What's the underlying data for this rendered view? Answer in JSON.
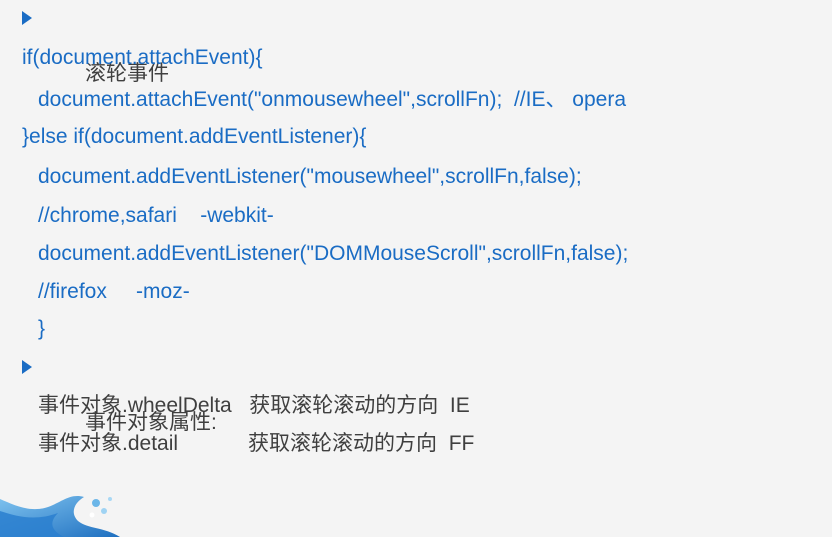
{
  "slide": {
    "bullet1": {
      "icon": "arrow-bullet-icon",
      "text": "滚轮事件"
    },
    "code_lines": [
      "if(document.attachEvent){",
      "document.attachEvent(\"onmousewheel\",scrollFn);  //IE、 opera",
      "}else if(document.addEventListener){",
      "document.addEventListener(\"mousewheel\",scrollFn,false);",
      "//chrome,safari    -webkit-",
      "document.addEventListener(\"DOMMouseScroll\",scrollFn,false);",
      "//firefox     -moz-",
      "}"
    ],
    "bullet2": {
      "icon": "arrow-bullet-icon",
      "text": "事件对象属性:"
    },
    "properties": [
      "事件对象.wheelDelta   获取滚轮滚动的方向  IE",
      "事件对象.detail            获取滚轮滚动的方向  FF"
    ],
    "colors": {
      "blue": "#1a6cc4",
      "dark": "#3f3f3f",
      "background": "#f4f4f4"
    },
    "decoration": "wave-splash-icon"
  }
}
